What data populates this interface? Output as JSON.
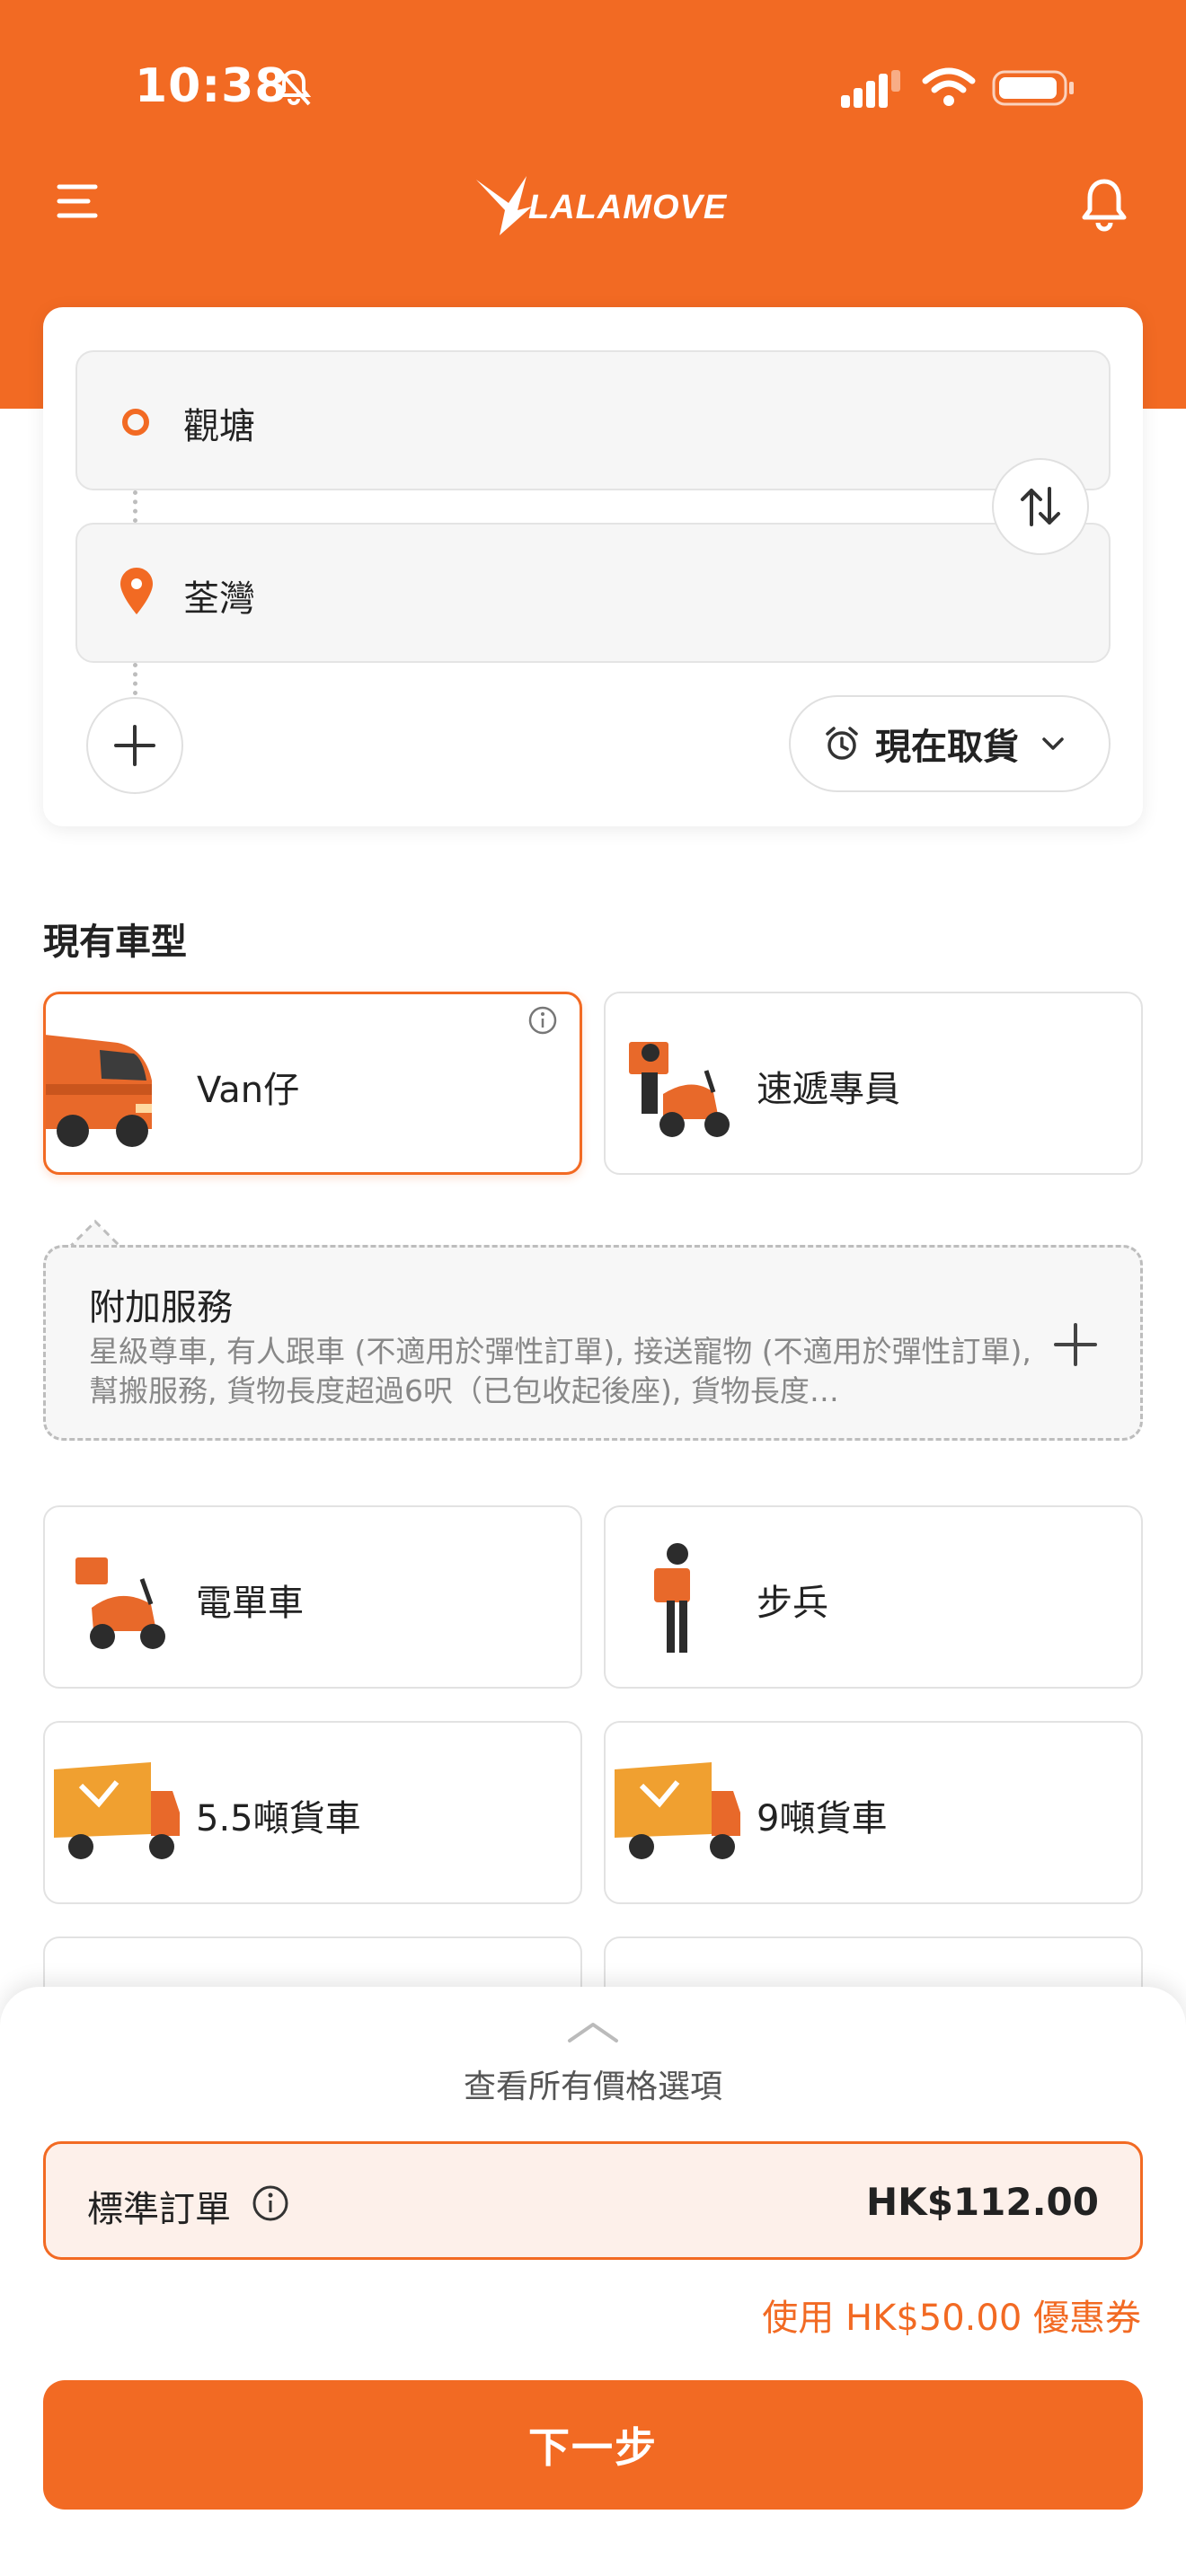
{
  "status_bar": {
    "time": "10:38"
  },
  "header": {
    "logo_text": "LALAMOVE"
  },
  "route": {
    "pickup": "觀塘",
    "dropoff": "荃灣",
    "pickup_time": "現在取貨"
  },
  "vehicles": {
    "section_title": "現有車型",
    "items": [
      {
        "label": "Van仔",
        "selected": true
      },
      {
        "label": "速遞專員"
      },
      {
        "label": "電單車"
      },
      {
        "label": "步兵"
      },
      {
        "label": "5.5噸貨車"
      },
      {
        "label": "9噸貨車"
      }
    ]
  },
  "addon": {
    "title": "附加服務",
    "description": "星級尊車, 有人跟車 (不適用於彈性訂單), 接送寵物 (不適用於彈性訂單), 幫搬服務, 貨物長度超過6呎（已包收起後座), 貨物長度…"
  },
  "bottom_sheet": {
    "title": "查看所有價格選項",
    "price_option_label": "標準訂單",
    "price_value": "HK$112.00",
    "coupon_text": "使用 HK$50.00 優惠券",
    "next_label": "下一步"
  },
  "colors": {
    "accent": "#f26a23",
    "price_row_bg": "#fdf0ea"
  }
}
